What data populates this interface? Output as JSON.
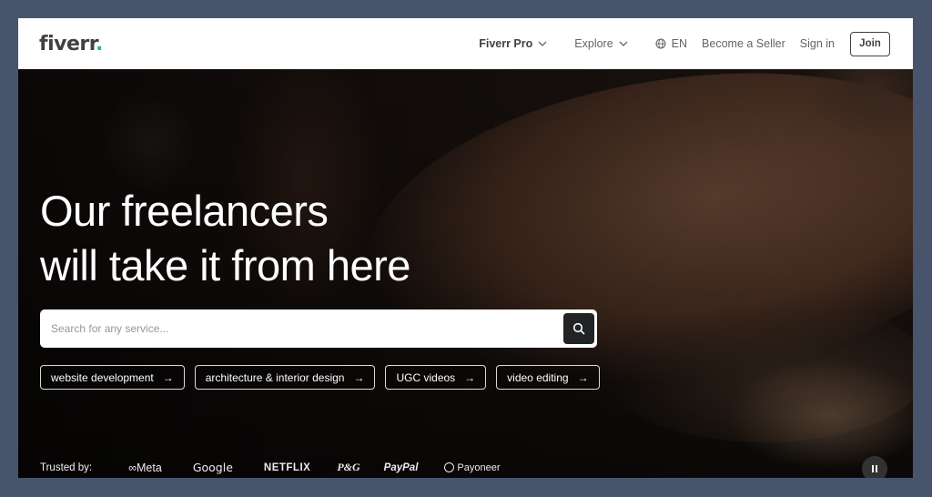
{
  "header": {
    "logo_text": "fiverr",
    "logo_dot": ".",
    "brand_color": "#1dbf73",
    "nav": {
      "pro": "Fiverr Pro",
      "explore": "Explore",
      "language": "EN",
      "become_seller": "Become a Seller",
      "sign_in": "Sign in",
      "join": "Join"
    }
  },
  "hero": {
    "headline_line1": "Our freelancers",
    "headline_line2": "will take it from here",
    "search": {
      "placeholder": "Search for any service...",
      "value": "",
      "icon": "search-icon"
    },
    "suggestions": [
      {
        "label": "website development",
        "arrow": "→"
      },
      {
        "label": "architecture & interior design",
        "arrow": "→"
      },
      {
        "label": "UGC videos",
        "arrow": "→"
      },
      {
        "label": "video editing",
        "arrow": "→"
      }
    ]
  },
  "trusted": {
    "label": "Trusted by:",
    "brands": {
      "meta": "∞Meta",
      "google": "Google",
      "netflix": "NETFLIX",
      "pg": "P&G",
      "paypal": "PayPal",
      "payoneer": "Payoneer"
    }
  },
  "video_control": {
    "icon": "pause-icon"
  }
}
